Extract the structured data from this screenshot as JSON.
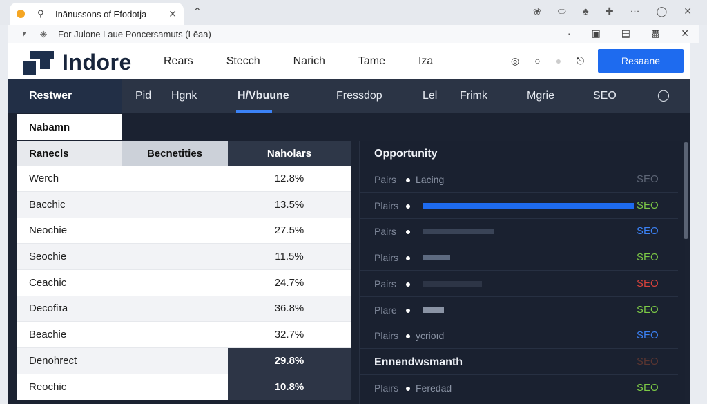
{
  "browser": {
    "tab_title": "Inānussons of Efodotja",
    "url": "For Julone Laue Poncersamuts (Lēaa)"
  },
  "app": {
    "logo": "Indore",
    "nav": [
      "Rears",
      "Stecch",
      "Narich",
      "Tame",
      "Iza"
    ],
    "cta": "Resaane"
  },
  "secondary_nav": {
    "first": "Restwer",
    "items": [
      "Pid",
      "Hgnk",
      "H/Vbuune",
      "Fressdop",
      "Lel",
      "Frimk",
      "Mgrie",
      "SEO"
    ],
    "active": "H/Vbuune"
  },
  "subtab": "Nabamn",
  "table": {
    "headers": [
      "Ranecls",
      "Becnetities",
      "Naholars"
    ],
    "rows": [
      {
        "name": "Werch",
        "value": "12.8%"
      },
      {
        "name": "Bacchic",
        "value": "13.5%"
      },
      {
        "name": "Neochie",
        "value": "27.5%"
      },
      {
        "name": "Seochie",
        "value": "11.5%"
      },
      {
        "name": "Ceachic",
        "value": "24.7%"
      },
      {
        "name": "Decofiɪa",
        "value": "36.8%"
      },
      {
        "name": "Beachie",
        "value": "32.7%"
      },
      {
        "name": "Denohrect",
        "value": "29.8%"
      },
      {
        "name": "Reochic",
        "value": "10.8%"
      }
    ]
  },
  "panel": {
    "title": "Opportunity",
    "rows": [
      {
        "label": "Pairs",
        "text": "Lacing",
        "seo": "SEO",
        "seo_color": "#5d6575",
        "bar": 0,
        "bar_color": "#1e6bef"
      },
      {
        "label": "Plairs",
        "text": "",
        "seo": "SEO",
        "seo_color": "#7cc946",
        "bar": 1.0,
        "bar_color": "#1e6bef"
      },
      {
        "label": "Pairs",
        "text": "",
        "seo": "SEO",
        "seo_color": "#3b82f6",
        "bar": 0.34,
        "bar_color": "#3a4457"
      },
      {
        "label": "Plairs",
        "text": "",
        "seo": "SEO",
        "seo_color": "#7cc946",
        "bar": 0.13,
        "bar_color": "#5d6a80"
      },
      {
        "label": "Pairs",
        "text": "",
        "seo": "SEO",
        "seo_color": "#d9423b",
        "bar": 0.28,
        "bar_color": "#2d3546"
      },
      {
        "label": "Plare",
        "text": "",
        "seo": "SEO",
        "seo_color": "#7cc946",
        "bar": 0.1,
        "bar_color": "#8a93a4"
      },
      {
        "label": "Plairs",
        "text": "ycrioıd",
        "seo": "SEO",
        "seo_color": "#3b82f6",
        "bar": 0,
        "bar_color": "#1e6bef"
      }
    ],
    "section2_title": "Ennendwsmanth",
    "section2_seo": "SEO",
    "section2_seo_color": "#5a3530",
    "last_row": {
      "label": "Plairs",
      "text": "Feredad",
      "seo": "SEO",
      "seo_color": "#7cc946"
    }
  }
}
